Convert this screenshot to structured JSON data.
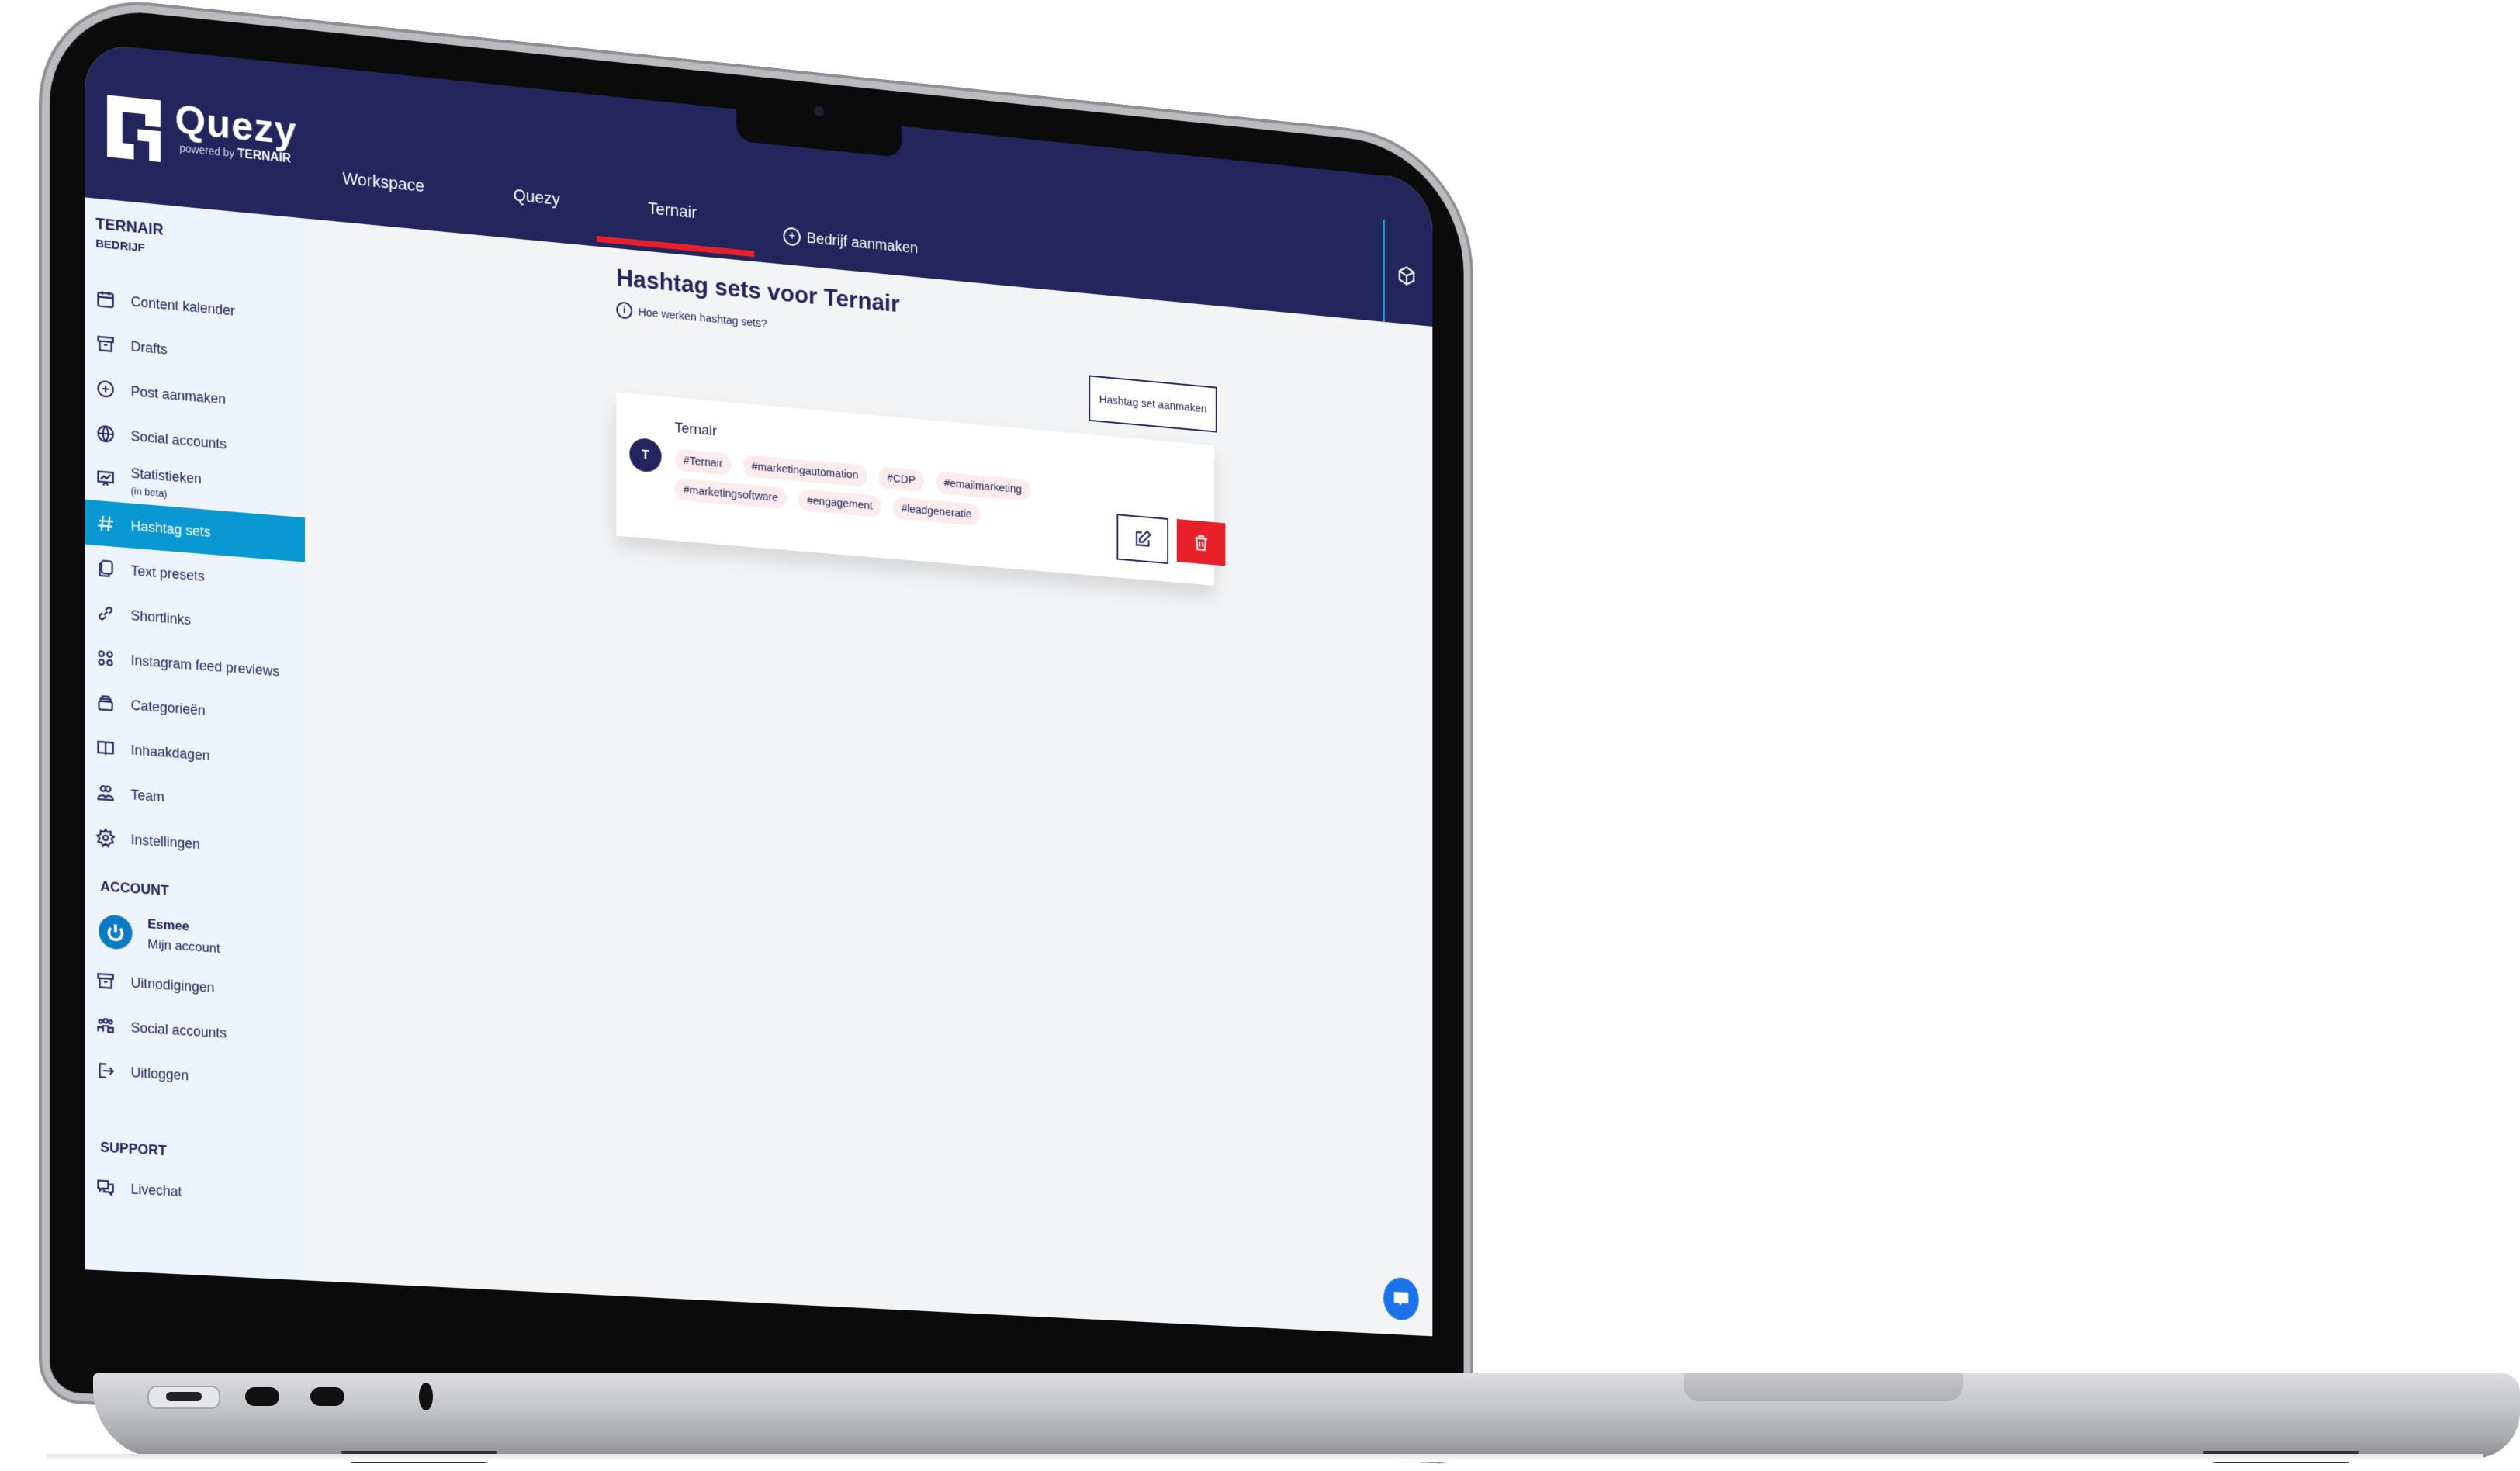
{
  "app": {
    "brand": "Quezy",
    "powered_by": "powered by",
    "powered_by_company": "TERNAIR"
  },
  "topnav": {
    "tabs": [
      {
        "label": "Workspace",
        "active": false
      },
      {
        "label": "Quezy",
        "active": false
      },
      {
        "label": "Ternair",
        "active": true
      }
    ],
    "create_company_label": "Bedrijf aanmaken"
  },
  "sidebar": {
    "org_name": "TERNAIR",
    "org_type": "BEDRIJF",
    "items": [
      {
        "label": "Content kalender",
        "icon": "calendar-icon"
      },
      {
        "label": "Drafts",
        "icon": "archive-icon"
      },
      {
        "label": "Post aanmaken",
        "icon": "plus-circle-icon"
      },
      {
        "label": "Social accounts",
        "icon": "globe-icon"
      },
      {
        "label": "Statistieken",
        "sub": "(in beta)",
        "icon": "presentation-chart-icon"
      },
      {
        "label": "Hashtag sets",
        "icon": "hashtag-icon",
        "active": true
      },
      {
        "label": "Text presets",
        "icon": "documents-icon"
      },
      {
        "label": "Shortlinks",
        "icon": "link-icon"
      },
      {
        "label": "Instagram feed previews",
        "icon": "grid-icon"
      },
      {
        "label": "Categorieën",
        "icon": "stack-icon"
      },
      {
        "label": "Inhaakdagen",
        "icon": "book-icon"
      },
      {
        "label": "Team",
        "icon": "team-icon"
      },
      {
        "label": "Instellingen",
        "icon": "gear-icon"
      }
    ],
    "account_title": "ACCOUNT",
    "account_user": {
      "name": "Esmee",
      "link": "Mijn account"
    },
    "account_items": [
      {
        "label": "Uitnodigingen",
        "icon": "archive-icon"
      },
      {
        "label": "Social accounts",
        "icon": "users-icon"
      },
      {
        "label": "Uitloggen",
        "icon": "logout-icon"
      }
    ],
    "support_title": "SUPPORT",
    "support_items": [
      {
        "label": "Livechat",
        "icon": "chat-icon"
      }
    ]
  },
  "main": {
    "title": "Hashtag sets voor Ternair",
    "help_link": "Hoe werken hashtag sets?",
    "create_button": "Hashtag set aanmaken",
    "sets": [
      {
        "avatar_letter": "T",
        "name": "Ternair",
        "tags": [
          "#Ternair",
          "#marketingautomation",
          "#CDP",
          "#emailmarketing",
          "#marketingsoftware",
          "#engagement",
          "#leadgeneratie"
        ]
      }
    ]
  },
  "colors": {
    "navy": "#22265c",
    "accent_blue": "#0a98d3",
    "danger_red": "#e8202a",
    "tag_bg": "#fdecee",
    "chat_blue": "#1a73e8"
  }
}
